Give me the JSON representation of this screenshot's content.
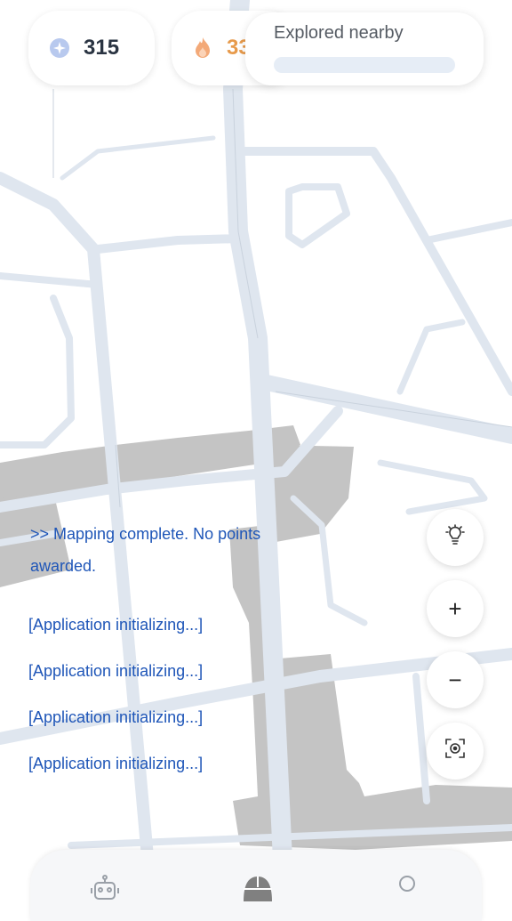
{
  "stats": {
    "points_icon": "sparkle-badge-icon",
    "points": "315",
    "streak_icon": "flame-icon",
    "streak": "33"
  },
  "explore": {
    "title": "Explored nearby",
    "progress": 0.0
  },
  "log": {
    "message": ">> Mapping complete. No points awarded.",
    "lines": [
      "[Application initializing...]",
      "[Application initializing...]",
      "[Application initializing...]",
      "[Application initializing...]"
    ]
  },
  "controls": {
    "hint_icon": "lightbulb-icon",
    "zoom_in": "+",
    "zoom_out": "−",
    "locate_icon": "locate-target-icon"
  },
  "nav": {
    "items": [
      "robot-icon",
      "mouse-icon",
      "profile-icon"
    ]
  },
  "colors": {
    "road": "#dfe6ef",
    "building": "#c4c4c4",
    "log_text": "#1f56b8",
    "streak": "#e79a4b"
  }
}
